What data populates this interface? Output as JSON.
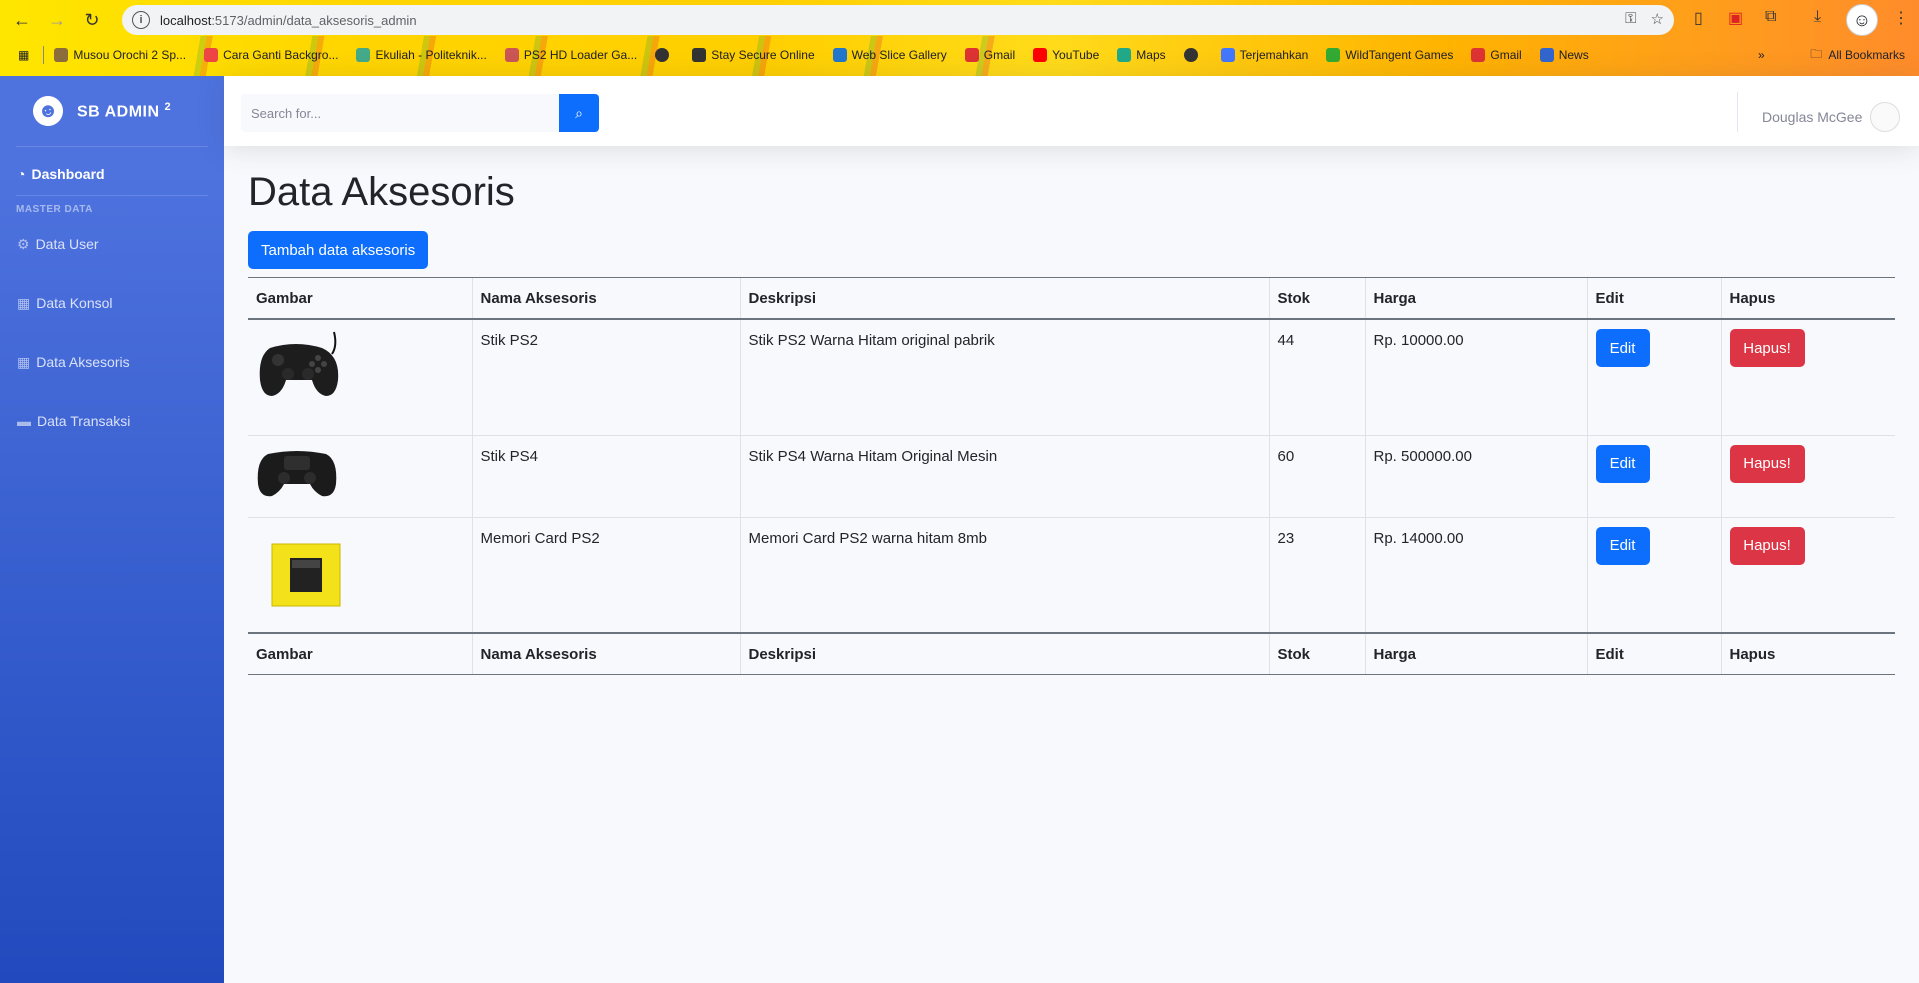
{
  "browser": {
    "url_host": "localhost",
    "url_path": ":5173/admin/data_aksesoris_admin",
    "bookmarks": [
      {
        "label": "Musou Orochi 2 Sp...",
        "color": "#8a6d3b"
      },
      {
        "label": "Cara Ganti Backgro...",
        "color": "#e44"
      },
      {
        "label": "Ekuliah - Politeknik...",
        "color": "#4a8"
      },
      {
        "label": "PS2 HD Loader Ga...",
        "color": "#c55"
      },
      {
        "label": "",
        "color": "#333"
      },
      {
        "label": "Stay Secure Online",
        "color": "#333"
      },
      {
        "label": "Web Slice Gallery",
        "color": "#27c"
      },
      {
        "label": "Gmail",
        "color": "#d33"
      },
      {
        "label": "YouTube",
        "color": "#f00"
      },
      {
        "label": "Maps",
        "color": "#2a8"
      },
      {
        "label": "",
        "color": "#333"
      },
      {
        "label": "Terjemahkan",
        "color": "#47f"
      },
      {
        "label": "WildTangent Games",
        "color": "#3a3"
      },
      {
        "label": "Gmail",
        "color": "#d33"
      },
      {
        "label": "News",
        "color": "#36c"
      }
    ],
    "all_bookmarks": "All Bookmarks"
  },
  "sidebar": {
    "brand": "SB ADMIN",
    "brand_sup": "2",
    "dashboard": "Dashboard",
    "heading": "MASTER DATA",
    "items": [
      {
        "label": "Data User",
        "icon": "gear-icon"
      },
      {
        "label": "Data Konsol",
        "icon": "table-icon"
      },
      {
        "label": "Data Aksesoris",
        "icon": "table-icon"
      },
      {
        "label": "Data Transaksi",
        "icon": "folder-icon"
      }
    ]
  },
  "topbar": {
    "search_placeholder": "Search for...",
    "user_name": "Douglas McGee"
  },
  "main": {
    "title": "Data Aksesoris",
    "add_button": "Tambah data aksesoris",
    "columns": [
      "Gambar",
      "Nama Aksesoris",
      "Deskripsi",
      "Stok",
      "Harga",
      "Edit",
      "Hapus"
    ],
    "rows": [
      {
        "nama": "Stik PS2",
        "deskripsi": "Stik PS2 Warna Hitam original pabrik",
        "stok": "44",
        "harga": "Rp. 10000.00",
        "edit": "Edit",
        "hapus": "Hapus!"
      },
      {
        "nama": "Stik PS4",
        "deskripsi": "Stik PS4 Warna Hitam Original Mesin",
        "stok": "60",
        "harga": "Rp. 500000.00",
        "edit": "Edit",
        "hapus": "Hapus!"
      },
      {
        "nama": "Memori Card PS2",
        "deskripsi": "Memori Card PS2 warna hitam 8mb",
        "stok": "23",
        "harga": "Rp. 14000.00",
        "edit": "Edit",
        "hapus": "Hapus!"
      }
    ]
  }
}
